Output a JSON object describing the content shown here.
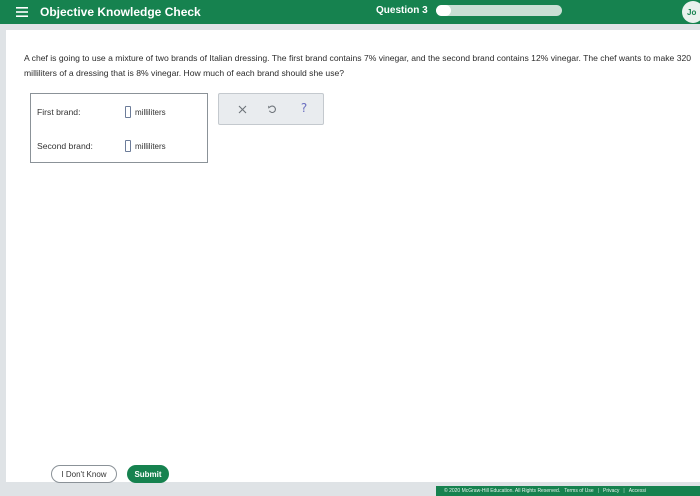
{
  "header": {
    "title": "Objective Knowledge Check",
    "question_label": "Question 3",
    "progress_fraction": 0.12,
    "avatar_text": "Jo",
    "icons": {
      "menu": "menu-icon"
    }
  },
  "problem": {
    "text": "A chef is going to use a mixture of two brands of Italian dressing. The first brand contains 7% vinegar, and the second brand contains 12% vinegar. The chef wants to make 320 milliliters of a dressing that is 8% vinegar. How much of each brand should she use?"
  },
  "answers": [
    {
      "label": "First brand:",
      "value": "",
      "unit": "milliliters"
    },
    {
      "label": "Second brand:",
      "value": "",
      "unit": "milliliters"
    }
  ],
  "tools": {
    "icons": [
      "close-icon",
      "undo-icon",
      "help-icon"
    ],
    "help_glyph": "?"
  },
  "footer": {
    "dont_know_label": "I Don't Know",
    "submit_label": "Submit",
    "copyright": "© 2020 McGraw-Hill Education. All Rights Reserved.",
    "terms": "Terms of Use",
    "privacy": "Privacy",
    "accessibility": "Accessi",
    "separator": "|"
  },
  "colors": {
    "brand_green": "#16824f",
    "page_bg": "#dfe3e6"
  }
}
